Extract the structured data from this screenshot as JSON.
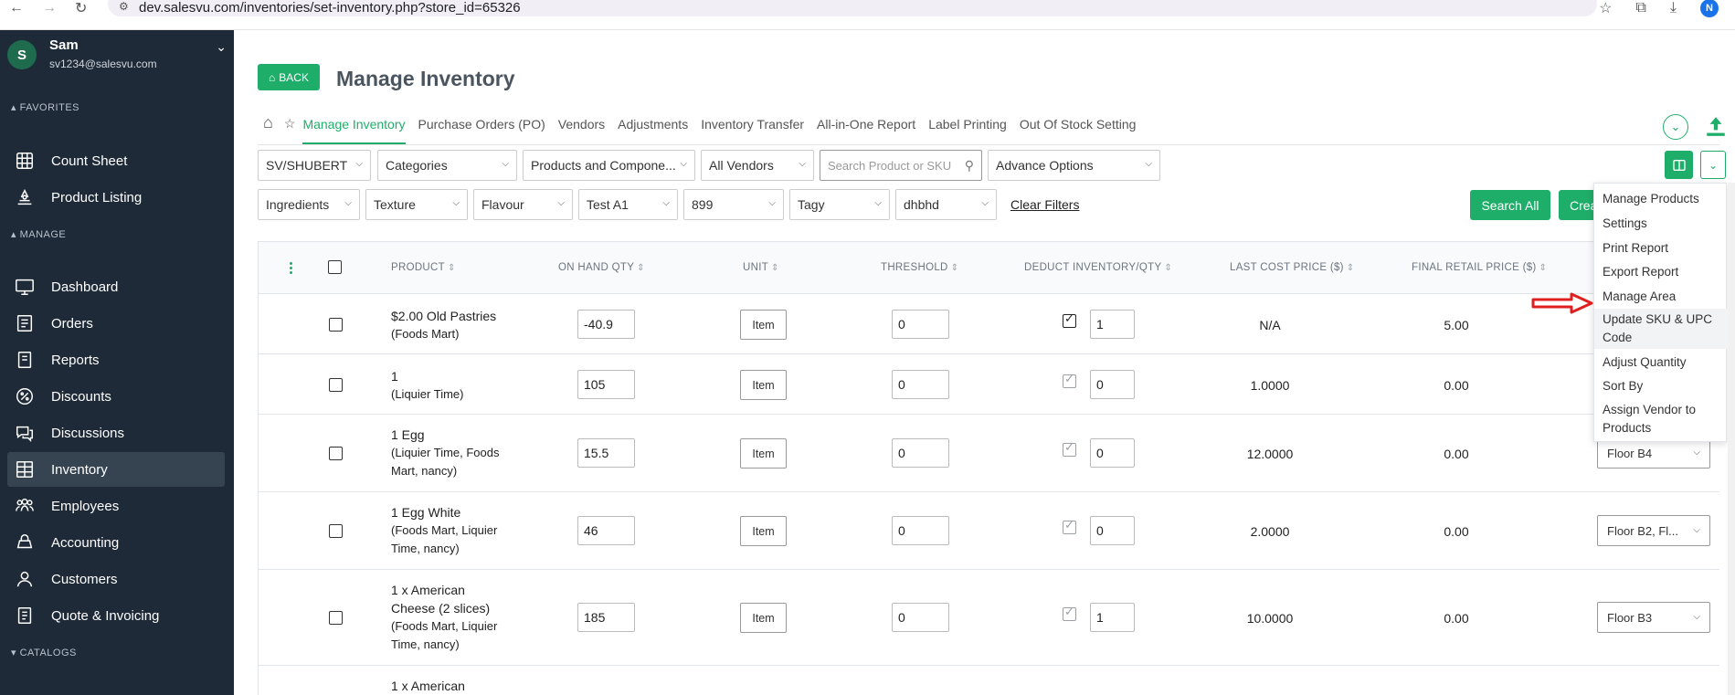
{
  "browser": {
    "url": "dev.salesvu.com/inventories/set-inventory.php?store_id=65326",
    "profile_initial": "N"
  },
  "sidebar": {
    "user": {
      "initial": "S",
      "name": "Sam",
      "email": "sv1234@salesvu.com"
    },
    "sections": {
      "favorites": "FAVORITES",
      "manage": "MANAGE",
      "catalogs": "CATALOGS"
    },
    "favorites": [
      {
        "label": "Count Sheet",
        "icon": "count-sheet-icon"
      },
      {
        "label": "Product Listing",
        "icon": "product-listing-icon"
      }
    ],
    "manage": [
      {
        "label": "Dashboard",
        "icon": "dashboard-icon"
      },
      {
        "label": "Orders",
        "icon": "orders-icon"
      },
      {
        "label": "Reports",
        "icon": "reports-icon"
      },
      {
        "label": "Discounts",
        "icon": "discounts-icon"
      },
      {
        "label": "Discussions",
        "icon": "discussions-icon"
      },
      {
        "label": "Inventory",
        "icon": "inventory-icon",
        "active": true
      },
      {
        "label": "Employees",
        "icon": "employees-icon"
      },
      {
        "label": "Accounting",
        "icon": "accounting-icon"
      },
      {
        "label": "Customers",
        "icon": "customers-icon"
      },
      {
        "label": "Quote & Invoicing",
        "icon": "quote-invoicing-icon"
      }
    ]
  },
  "header": {
    "back_label": "BACK",
    "title": "Manage Inventory"
  },
  "tabs": [
    {
      "label": "Manage Inventory",
      "active": true
    },
    {
      "label": "Purchase Orders (PO)"
    },
    {
      "label": "Vendors"
    },
    {
      "label": "Adjustments"
    },
    {
      "label": "Inventory Transfer"
    },
    {
      "label": "All-in-One Report"
    },
    {
      "label": "Label Printing"
    },
    {
      "label": "Out Of Stock Setting"
    }
  ],
  "filters": {
    "store": "SV/SHUBERT",
    "categories": "Categories",
    "products": "Products and Compone...",
    "vendors": "All Vendors",
    "search_placeholder": "Search Product or SKU",
    "advance": "Advance Options",
    "ingredients": "Ingredients",
    "texture": "Texture",
    "flavour": "Flavour",
    "test": "Test A1",
    "num": "899",
    "tagy": "Tagy",
    "dhbhd": "dhbhd",
    "clear": "Clear Filters",
    "search_all": "Search All",
    "create_partial": "Crea"
  },
  "table": {
    "headers": {
      "product": "PRODUCT",
      "on_hand": "ON HAND QTY",
      "unit": "UNIT",
      "threshold": "THRESHOLD",
      "deduct": "DEDUCT INVENTORY/QTY",
      "last_cost": "LAST COST PRICE ($)",
      "final_retail": "FINAL RETAIL PRICE ($)"
    },
    "rows": [
      {
        "name": "$2.00 Old Pastries",
        "vendors": "(Foods Mart)",
        "qty": "-40.9",
        "unit": "Item",
        "threshold": "0",
        "deduct": "1",
        "cost": "N/A",
        "retail": "5.00",
        "area": ""
      },
      {
        "name": "1",
        "vendors": "(Liquier Time)",
        "qty": "105",
        "unit": "Item",
        "threshold": "0",
        "deduct": "0",
        "cost": "1.0000",
        "retail": "0.00",
        "area": ""
      },
      {
        "name": "1 Egg",
        "vendors": "(Liquier Time, Foods Mart, nancy)",
        "qty": "15.5",
        "unit": "Item",
        "threshold": "0",
        "deduct": "0",
        "cost": "12.0000",
        "retail": "0.00",
        "area": "Floor B4"
      },
      {
        "name": "1 Egg White",
        "vendors": "(Foods Mart, Liquier Time, nancy)",
        "qty": "46",
        "unit": "Item",
        "threshold": "0",
        "deduct": "0",
        "cost": "2.0000",
        "retail": "0.00",
        "area": "Floor B2, Fl..."
      },
      {
        "name": "1 x American Cheese (2 slices)",
        "vendors": "(Foods Mart, Liquier Time, nancy)",
        "qty": "185",
        "unit": "Item",
        "threshold": "0",
        "deduct": "1",
        "cost": "10.0000",
        "retail": "0.00",
        "area": "Floor B3"
      },
      {
        "name": "1 x American",
        "vendors": "",
        "qty": "",
        "unit": "",
        "threshold": "",
        "deduct": "",
        "cost": "",
        "retail": "",
        "area": ""
      }
    ]
  },
  "menu": {
    "items": [
      "Manage Products",
      "Settings",
      "Print Report",
      "Export Report",
      "Manage Area",
      "Update SKU & UPC Code",
      "Adjust Quantity",
      "Sort By",
      "Assign Vendor to Products"
    ]
  },
  "colors": {
    "accent": "#1fae6a",
    "sidebar": "#1e2a38",
    "arrow": "#e02020"
  }
}
